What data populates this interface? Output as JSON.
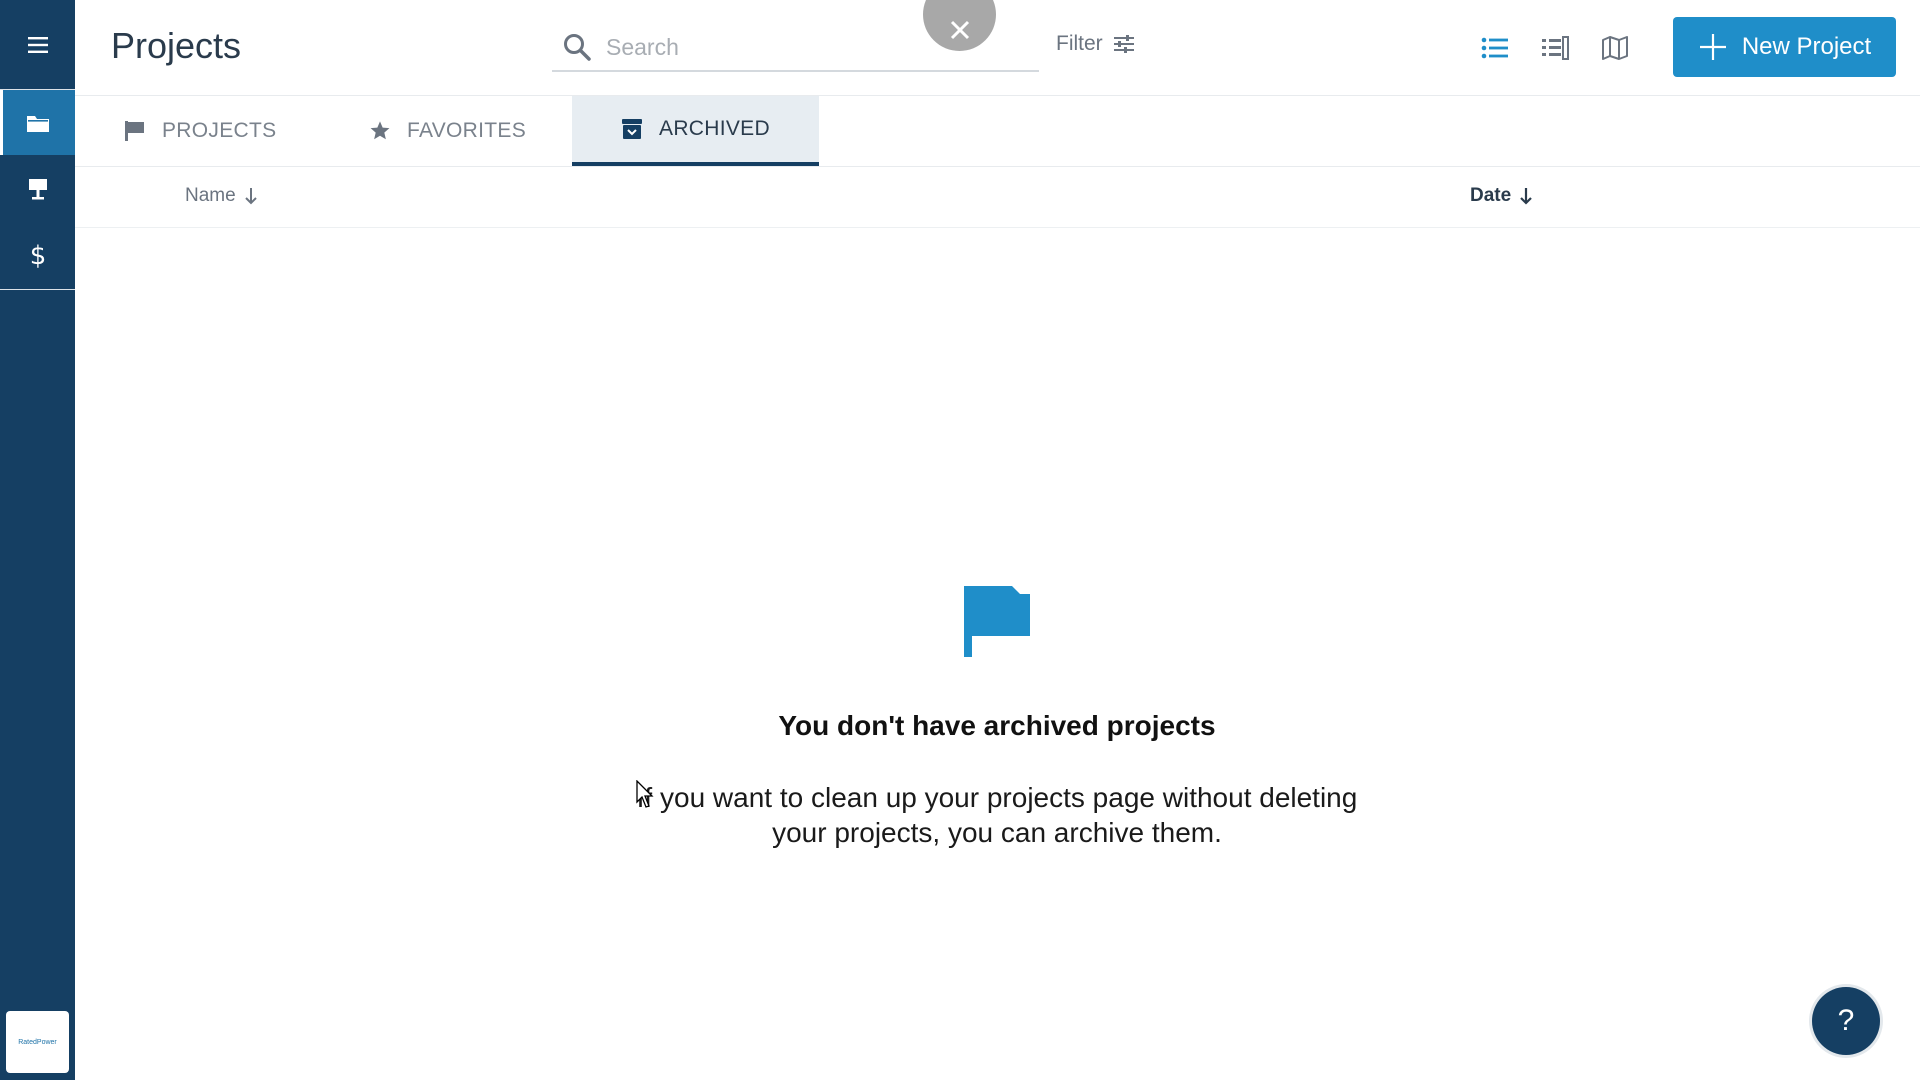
{
  "header": {
    "title": "Projects",
    "search_placeholder": "Search",
    "filter_label": "Filter",
    "new_project_label": "New Project"
  },
  "sidebar": {
    "items": [
      {
        "icon": "hamburger-menu-icon"
      },
      {
        "icon": "folder-icon",
        "active": true
      },
      {
        "icon": "lamp-icon"
      },
      {
        "icon": "dollar-icon"
      }
    ],
    "logo_text": "RatedPower"
  },
  "tabs": [
    {
      "label": "PROJECTS",
      "icon": "flag-icon",
      "active": false
    },
    {
      "label": "FAVORITES",
      "icon": "star-icon",
      "active": false
    },
    {
      "label": "ARCHIVED",
      "icon": "archive-icon",
      "active": true
    }
  ],
  "columns": {
    "name": "Name",
    "date": "Date"
  },
  "empty_state": {
    "title": "You don't have archived projects",
    "line1": "If you want to clean up your projects page without deleting",
    "line2": "your projects, you can archive them."
  },
  "help_label": "?",
  "colors": {
    "sidebar": "#153f63",
    "accent": "#1f8ec9",
    "active_sidebar": "#1f73a8"
  }
}
